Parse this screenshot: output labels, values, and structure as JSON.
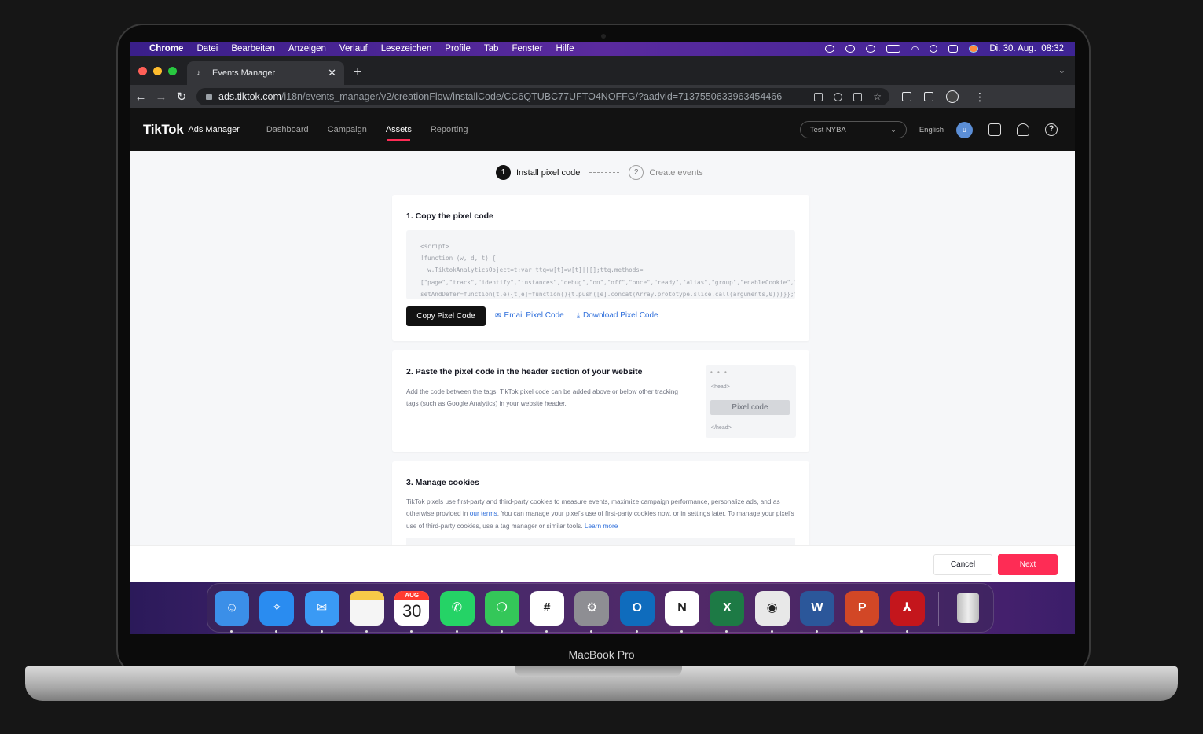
{
  "device": {
    "label": "MacBook Pro"
  },
  "menubar": {
    "items": [
      "Chrome",
      "Datei",
      "Bearbeiten",
      "Anzeigen",
      "Verlauf",
      "Lesezeichen",
      "Profile",
      "Tab",
      "Fenster",
      "Hilfe"
    ],
    "datetime": "Di. 30. Aug.  08:32"
  },
  "browser": {
    "tab_title": "Events Manager",
    "url_host": "ads.tiktok.com",
    "url_path": "/i18n/events_manager/v2/creationFlow/installCode/CC6QTUBC77UFTO4NOFFG/?aadvid=7137550633963454466"
  },
  "header": {
    "logo": "TikTok",
    "logo_sub": "Ads Manager",
    "nav": [
      "Dashboard",
      "Campaign",
      "Assets",
      "Reporting"
    ],
    "active_nav": "Assets",
    "account": "Test NYBA",
    "language": "English",
    "avatar_initial": "u"
  },
  "steps": [
    {
      "num": "1",
      "label": "Install pixel code"
    },
    {
      "num": "2",
      "label": "Create events"
    }
  ],
  "section1": {
    "title": "1. Copy the pixel code",
    "code_lines": [
      "<script>",
      "!function (w, d, t) {",
      "  w.TiktokAnalyticsObject=t;var ttq=w[t]=w[t]||[];ttq.methods=",
      "[\"page\",\"track\",\"identify\",\"instances\",\"debug\",\"on\",\"off\",\"once\",\"ready\",\"alias\",\"group\",\"enableCookie\",\"disableCookie\"],ttq.",
      "setAndDefer=function(t,e){t[e]=function(){t.push([e].concat(Array.prototype.slice.call(arguments,0)))}};for(var"
    ],
    "copy_button": "Copy Pixel Code",
    "email_link": "Email Pixel Code",
    "download_link": "Download Pixel Code"
  },
  "section2": {
    "title": "2. Paste the pixel code in the header section of your website",
    "description": "Add the code between the tags. TikTok pixel code can be added above or below other tracking tags (such as Google Analytics) in your website header.",
    "illus_dots": "• • •",
    "illus_head": "<head>",
    "illus_code": "Pixel code",
    "illus_endhead": "</head>"
  },
  "section3": {
    "title": "3. Manage cookies",
    "desc_part1": "TikTok pixels use first-party and third-party cookies to measure events, maximize campaign performance, personalize ads, and as otherwise provided in ",
    "terms_link": "our terms",
    "desc_part2": ". You can manage your pixel's use of first-party cookies now, or in settings later. To manage your pixel's use of third-party cookies, use a tag manager or similar tools. ",
    "learn_more": "Learn more"
  },
  "footer": {
    "cancel": "Cancel",
    "next": "Next"
  },
  "dock": {
    "calendar_month": "AUG",
    "calendar_day": "30",
    "apps": [
      {
        "name": "finder-icon",
        "color": "#3b8fe8",
        "glyph": "☺"
      },
      {
        "name": "safari-icon",
        "color": "#2a8cf0",
        "glyph": "✧"
      },
      {
        "name": "mail-icon",
        "color": "#3a9af5",
        "glyph": "✉"
      },
      {
        "name": "notes-icon",
        "color": "#f5f5f5",
        "glyph": ""
      },
      {
        "name": "calendar-icon",
        "color": "#ffffff",
        "glyph": ""
      },
      {
        "name": "whatsapp-icon",
        "color": "#25d366",
        "glyph": "✆"
      },
      {
        "name": "messages-icon",
        "color": "#34c759",
        "glyph": "❍"
      },
      {
        "name": "slack-icon",
        "color": "#ffffff",
        "glyph": "#"
      },
      {
        "name": "system-settings-icon",
        "color": "#8e8e93",
        "glyph": "⚙"
      },
      {
        "name": "outlook-icon",
        "color": "#0f6cbd",
        "glyph": "O"
      },
      {
        "name": "notion-icon",
        "color": "#ffffff",
        "glyph": "N"
      },
      {
        "name": "excel-icon",
        "color": "#1d7a45",
        "glyph": "X"
      },
      {
        "name": "chrome-icon",
        "color": "#e8e8e8",
        "glyph": "◉"
      },
      {
        "name": "word-icon",
        "color": "#2b579a",
        "glyph": "W"
      },
      {
        "name": "powerpoint-icon",
        "color": "#d24726",
        "glyph": "P"
      },
      {
        "name": "acrobat-icon",
        "color": "#c4161c",
        "glyph": "⅄"
      }
    ]
  }
}
